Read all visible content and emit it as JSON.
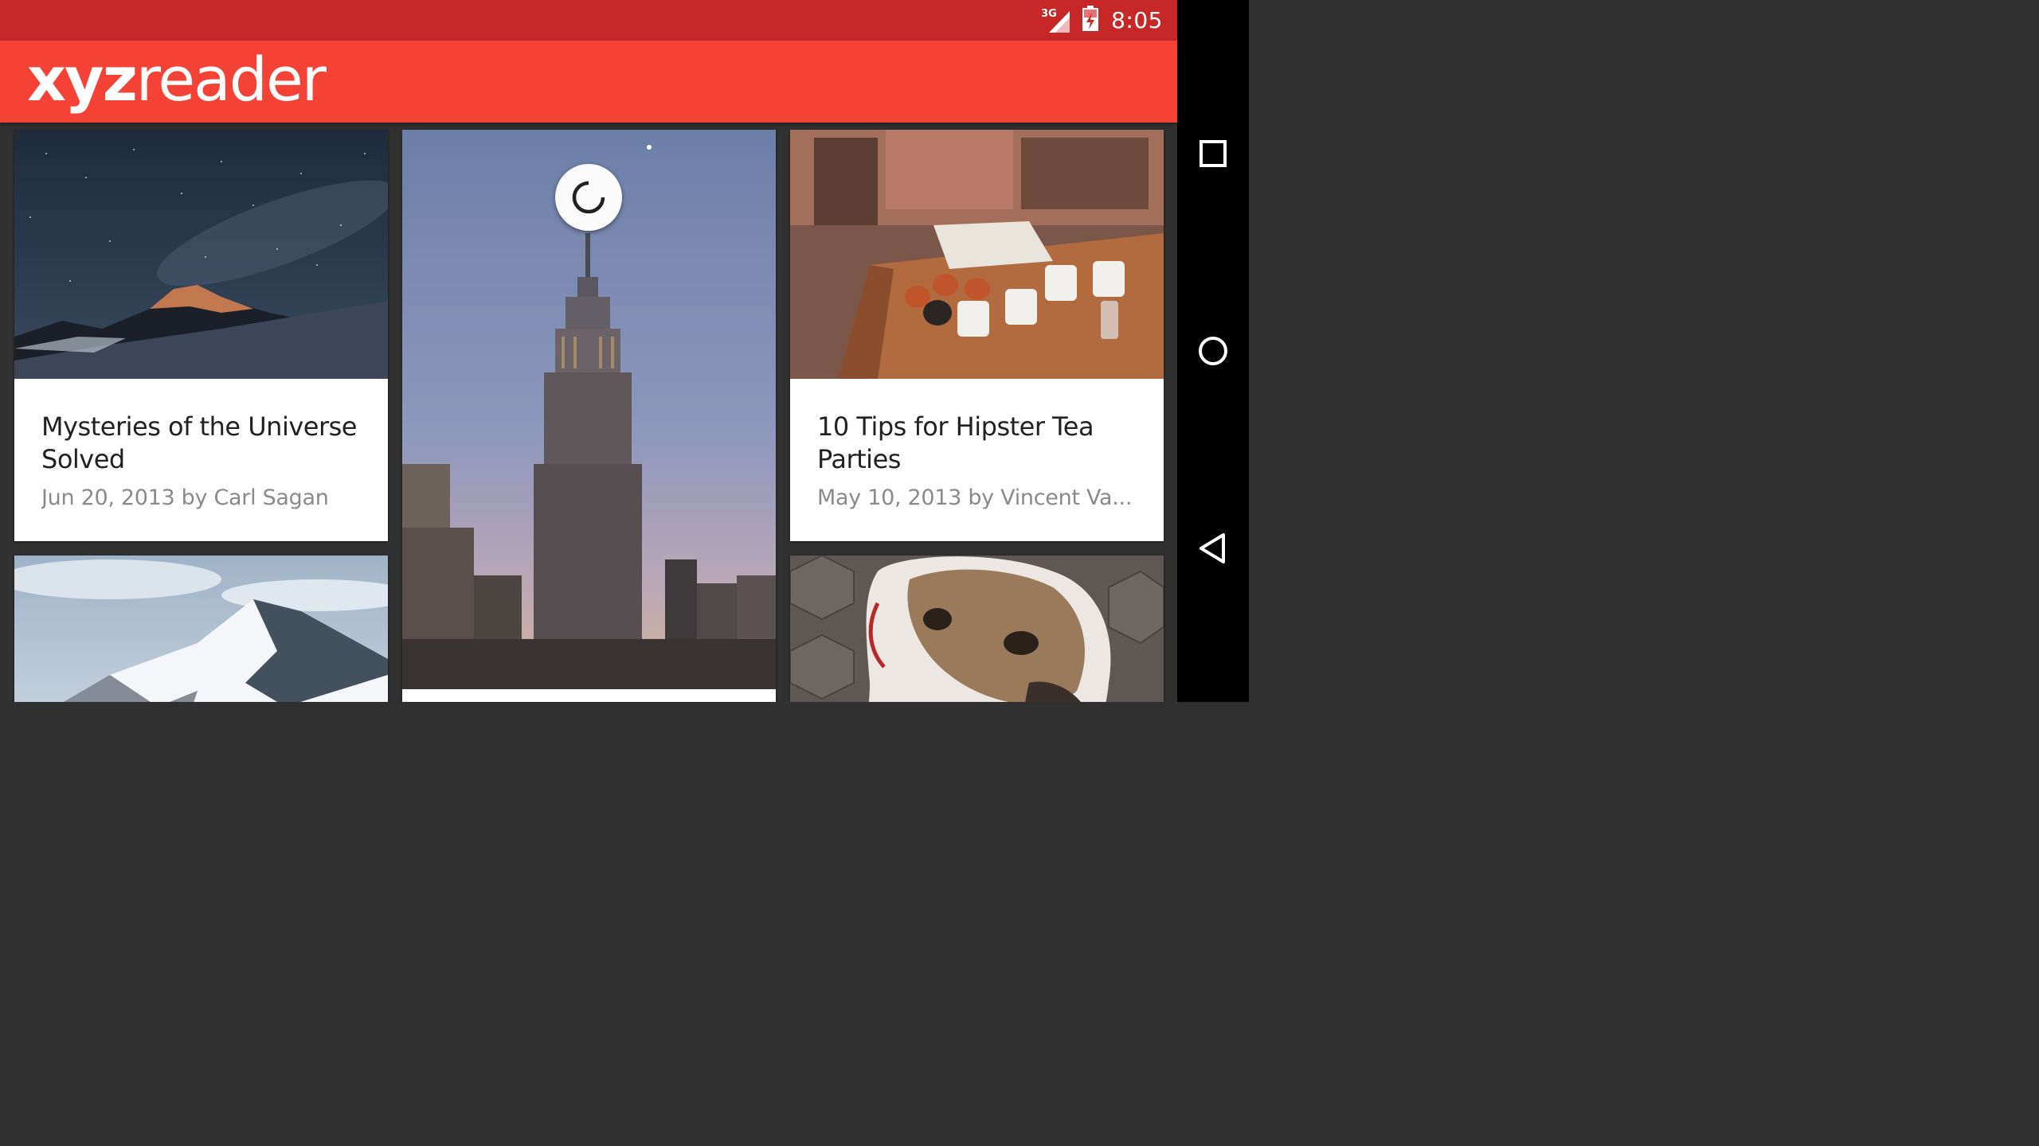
{
  "status_bar": {
    "network": "3G",
    "time": "8:05",
    "icons": [
      "signal-icon",
      "battery-icon"
    ]
  },
  "toolbar": {
    "logo_bold": "xyz",
    "logo_light": "reader"
  },
  "articles": [
    {
      "title": "Mysteries of the Universe Solved",
      "subtitle": "Jun 20, 2013 by Carl Sagan",
      "image": "night-sky-mountain"
    },
    {
      "title": "",
      "subtitle": "",
      "image": "empire-state-building"
    },
    {
      "title": "10 Tips for Hipster Tea Parties",
      "subtitle": "May 10, 2013 by Vincent Va...",
      "image": "tea-cups-table"
    },
    {
      "title": "",
      "subtitle": "",
      "image": "snowy-mountain-peak"
    },
    {
      "title": "",
      "subtitle": "",
      "image": "bulldog"
    }
  ],
  "loading": true,
  "nav_bar": {
    "buttons": [
      "recents-icon",
      "home-icon",
      "back-icon"
    ]
  },
  "colors": {
    "status_bar": "#c62828",
    "toolbar": "#f44336",
    "background": "#303030",
    "card": "#ffffff",
    "title_text": "#212121",
    "subtitle_text": "#8a8a8a"
  }
}
